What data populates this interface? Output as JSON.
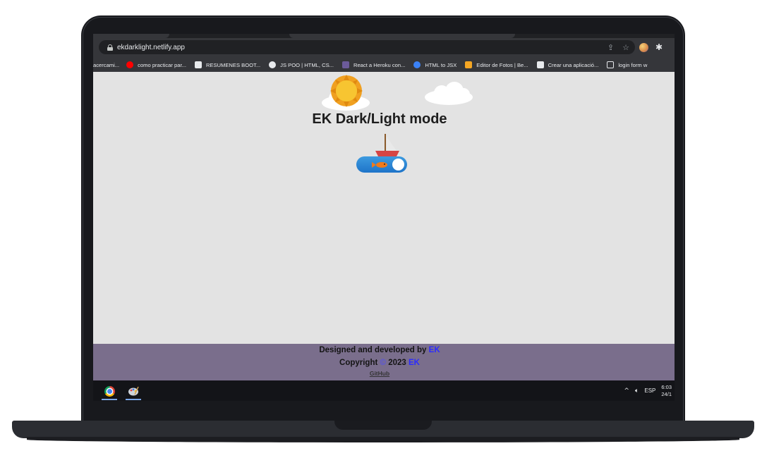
{
  "browser": {
    "url": "ekdarklight.netlify.app",
    "bookmarks": [
      {
        "label": "acercami...",
        "icon": "none-icon",
        "color": "#35363a"
      },
      {
        "label": "como practicar par...",
        "icon": "youtube-icon",
        "color": "#ff0000"
      },
      {
        "label": "RESUMENES BOOT...",
        "icon": "notion-icon",
        "color": "#e8eaed"
      },
      {
        "label": "JS POO | HTML, CS...",
        "icon": "github-icon",
        "color": "#e8eaed"
      },
      {
        "label": "React a Heroku con...",
        "icon": "heroku-icon",
        "color": "#6c5b9a"
      },
      {
        "label": "HTML to JSX",
        "icon": "transform-icon",
        "color": "#3b82f6"
      },
      {
        "label": "Editor de Fotos | Be...",
        "icon": "befunky-icon",
        "color": "#f5a623"
      },
      {
        "label": "Crear una aplicació...",
        "icon": "dev-icon",
        "color": "#e8eaed"
      },
      {
        "label": "login form w",
        "icon": "page-icon",
        "color": "#35363a"
      }
    ]
  },
  "page": {
    "title": "EK Dark/Light mode",
    "toggle_state": "light"
  },
  "footer": {
    "designed_text": "Designed and developed by ",
    "designed_author": "EK",
    "copyright_text": "Copyright ",
    "copyright_symbol": "©",
    "year": "2023",
    "copyright_author": "EK",
    "github_link": "GitHub"
  },
  "taskbar": {
    "lang": "ESP",
    "time": "6:03",
    "date": "24/1"
  }
}
